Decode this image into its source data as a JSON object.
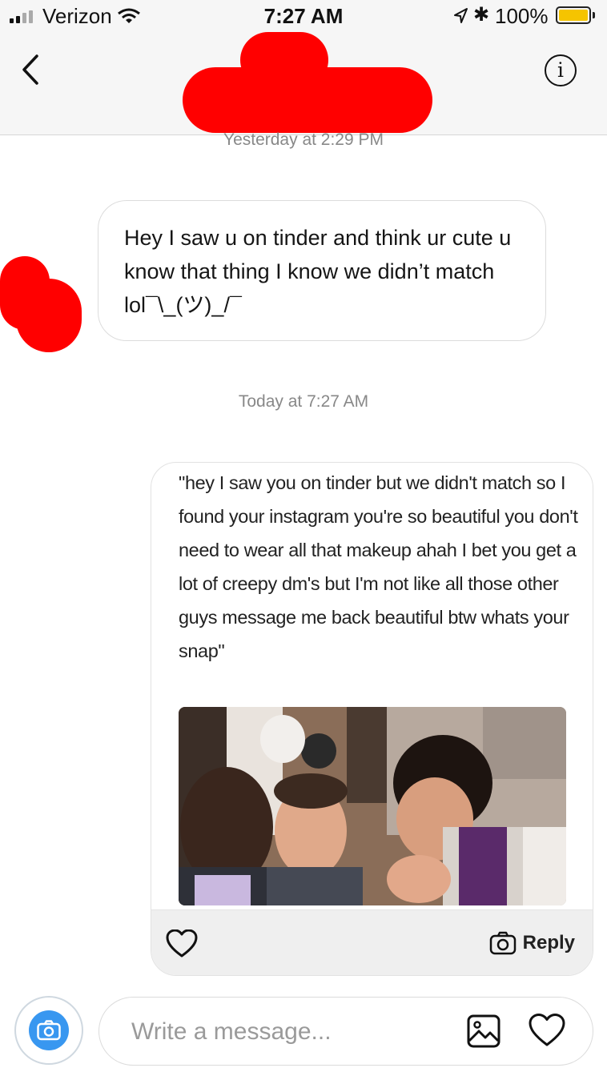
{
  "status": {
    "carrier": "Verizon",
    "time": "7:27 AM",
    "battery": "100%",
    "battery_level": 1.0
  },
  "header": {
    "back_icon": "chevron-left-icon",
    "info_label": "i",
    "info_icon": "info-icon"
  },
  "thread": {
    "timestamp_1": "Yesterday at 2:29 PM",
    "received_message": "Hey I saw u on tinder and think ur cute u know that thing I know we didn’t match lol¯\\_(ツ)_/¯",
    "timestamp_2": "Today at 7:27 AM",
    "shared_post": {
      "caption": "\"hey I saw you on tinder but we didn't match so I found your instagram you're so beautiful you don't need to wear all that makeup ahah I bet you get a lot of creepy dm's but I'm not like all those other guys message me back beautiful btw whats your snap\"",
      "reply_label": "Reply",
      "heart_icon": "heart-icon",
      "camera_icon": "camera-icon"
    }
  },
  "composer": {
    "placeholder": "Write a message...",
    "camera_icon": "camera-icon",
    "gallery_icon": "image-icon",
    "like_icon": "heart-icon"
  },
  "colors": {
    "accent": "#3897f0",
    "redaction": "#ff0000",
    "battery": "#f5c400"
  }
}
